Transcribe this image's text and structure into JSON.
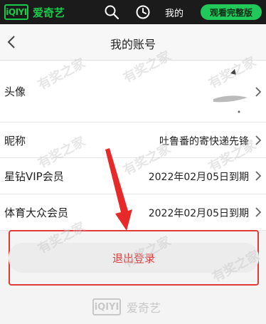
{
  "topbar": {
    "logo_mark": "iQIYI",
    "logo_text": "爱奇艺",
    "search_icon": "search-icon",
    "history_icon": "history-icon",
    "mine_label": "我的",
    "watch_full_label": "观看完整版"
  },
  "header": {
    "title": "我的账号",
    "back_icon": "chevron-left-icon"
  },
  "rows": [
    {
      "label": "头像",
      "value": ""
    },
    {
      "label": "昵称",
      "value": "吐鲁番的寄快递先锋"
    },
    {
      "label": "星钻VIP会员",
      "value": "2022年02月05日到期"
    },
    {
      "label": "体育大众会员",
      "value": "2022年02月05日到期"
    }
  ],
  "logout": {
    "label": "退出登录"
  },
  "footer": {
    "logo_mark": "iQIYI",
    "logo_text": "爱奇艺"
  },
  "watermark": {
    "text": "有奖之家"
  },
  "colors": {
    "accent_green": "#21c95a",
    "logout_red": "#e23a3a",
    "topbar_bg": "#1b1b1b"
  }
}
